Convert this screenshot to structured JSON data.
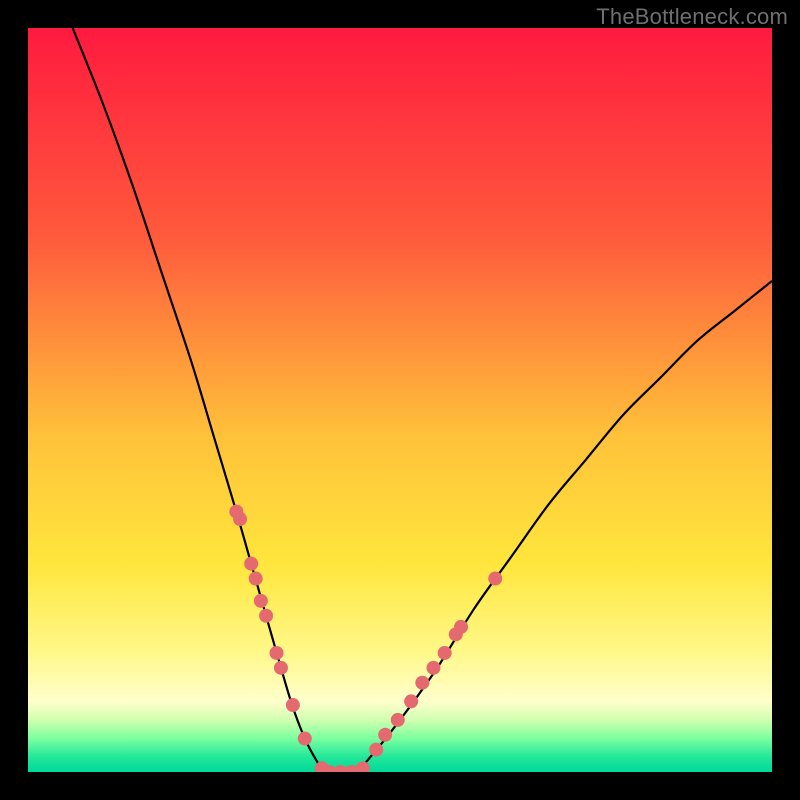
{
  "watermark": "TheBottleneck.com",
  "chart_data": {
    "type": "line",
    "title": "",
    "xlabel": "",
    "ylabel": "",
    "xlim": [
      0,
      100
    ],
    "ylim": [
      0,
      100
    ],
    "grid": false,
    "background": {
      "type": "vertical-gradient",
      "stops": [
        {
          "pos": 0.0,
          "color": "#ff1a3f"
        },
        {
          "pos": 0.28,
          "color": "#ff5a3c"
        },
        {
          "pos": 0.55,
          "color": "#ffc23a"
        },
        {
          "pos": 0.72,
          "color": "#ffe63c"
        },
        {
          "pos": 0.84,
          "color": "#fff88a"
        },
        {
          "pos": 0.905,
          "color": "#ffffcc"
        },
        {
          "pos": 0.93,
          "color": "#d0ffb0"
        },
        {
          "pos": 0.955,
          "color": "#7bff9f"
        },
        {
          "pos": 0.98,
          "color": "#22e79a"
        },
        {
          "pos": 1.0,
          "color": "#00d89a"
        }
      ]
    },
    "series": [
      {
        "name": "bottleneck-curve",
        "color": "#000000",
        "x": [
          6,
          10,
          14,
          18,
          22,
          25,
          28,
          30,
          32,
          34,
          35.5,
          37,
          38.5,
          40,
          42,
          44,
          46,
          50,
          55,
          60,
          65,
          70,
          75,
          80,
          85,
          90,
          95,
          100
        ],
        "y": [
          100,
          90,
          79,
          67,
          55,
          45,
          35,
          28,
          21,
          14,
          9,
          5,
          2,
          0,
          0,
          0,
          2,
          7,
          14,
          22,
          29,
          36,
          42,
          48,
          53,
          58,
          62,
          66
        ]
      }
    ],
    "markers": {
      "name": "highlight-dots",
      "color": "#e56a6f",
      "radius_px": 7,
      "points": [
        {
          "x": 28.0,
          "y": 35
        },
        {
          "x": 28.5,
          "y": 34
        },
        {
          "x": 30.0,
          "y": 28
        },
        {
          "x": 30.6,
          "y": 26
        },
        {
          "x": 31.3,
          "y": 23
        },
        {
          "x": 32.0,
          "y": 21
        },
        {
          "x": 33.4,
          "y": 16
        },
        {
          "x": 34.0,
          "y": 14
        },
        {
          "x": 35.6,
          "y": 9
        },
        {
          "x": 37.2,
          "y": 4.5
        },
        {
          "x": 39.5,
          "y": 0.5
        },
        {
          "x": 40.5,
          "y": 0
        },
        {
          "x": 42.0,
          "y": 0
        },
        {
          "x": 43.5,
          "y": 0
        },
        {
          "x": 45.0,
          "y": 0.5
        },
        {
          "x": 46.8,
          "y": 3
        },
        {
          "x": 48.0,
          "y": 5
        },
        {
          "x": 49.7,
          "y": 7
        },
        {
          "x": 51.5,
          "y": 9.5
        },
        {
          "x": 53.0,
          "y": 12
        },
        {
          "x": 54.5,
          "y": 14
        },
        {
          "x": 56.0,
          "y": 16
        },
        {
          "x": 57.5,
          "y": 18.5
        },
        {
          "x": 58.2,
          "y": 19.5
        },
        {
          "x": 62.8,
          "y": 26
        }
      ]
    }
  }
}
